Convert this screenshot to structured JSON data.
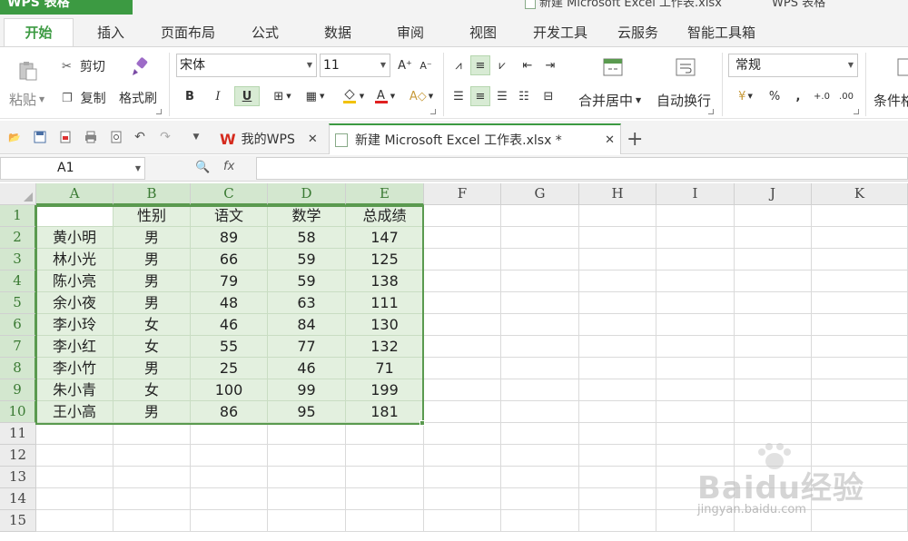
{
  "app": {
    "name": "WPS 表格",
    "document_title": "新建 Microsoft Excel 工作表.xlsx",
    "app_title": "WPS 表格"
  },
  "menu": {
    "tabs": [
      "开始",
      "插入",
      "页面布局",
      "公式",
      "数据",
      "审阅",
      "视图",
      "开发工具",
      "云服务",
      "智能工具箱"
    ],
    "active": "开始"
  },
  "ribbon": {
    "paste": "粘贴",
    "cut": "剪切",
    "copy": "复制",
    "format_painter": "格式刷",
    "font_name": "宋体",
    "font_size": "11",
    "grow_font": "A⁺",
    "shrink_font": "A⁻",
    "bold": "B",
    "italic": "I",
    "underline": "U",
    "merge_center": "合并居中",
    "wrap_text": "自动换行",
    "number_format": "常规",
    "percent": "%",
    "comma": ",",
    "conditional": "条件格"
  },
  "tabs_bar": {
    "tabs": [
      {
        "label": "我的WPS",
        "active": false
      },
      {
        "label": "新建 Microsoft Excel 工作表.xlsx *",
        "active": true
      }
    ],
    "new_tab": "+"
  },
  "formula_bar": {
    "cell_ref": "A1",
    "fx": "fx",
    "value": ""
  },
  "sheet": {
    "columns": [
      "A",
      "B",
      "C",
      "D",
      "E",
      "F",
      "G",
      "H",
      "I",
      "J",
      "K"
    ],
    "selected_columns": [
      "A",
      "B",
      "C",
      "D",
      "E"
    ],
    "rows": [
      "1",
      "2",
      "3",
      "4",
      "5",
      "6",
      "7",
      "8",
      "9",
      "10",
      "11",
      "12",
      "13",
      "14",
      "15"
    ],
    "selected_rows": [
      "1",
      "2",
      "3",
      "4",
      "5",
      "6",
      "7",
      "8",
      "9",
      "10"
    ],
    "data": [
      [
        "",
        "性别",
        "语文",
        "数学",
        "总成绩"
      ],
      [
        "黄小明",
        "男",
        "89",
        "58",
        "147"
      ],
      [
        "林小光",
        "男",
        "66",
        "59",
        "125"
      ],
      [
        "陈小亮",
        "男",
        "79",
        "59",
        "138"
      ],
      [
        "余小夜",
        "男",
        "48",
        "63",
        "111"
      ],
      [
        "李小玲",
        "女",
        "46",
        "84",
        "130"
      ],
      [
        "李小红",
        "女",
        "55",
        "77",
        "132"
      ],
      [
        "李小竹",
        "男",
        "25",
        "46",
        "71"
      ],
      [
        "朱小青",
        "女",
        "100",
        "99",
        "199"
      ],
      [
        "王小高",
        "男",
        "86",
        "95",
        "181"
      ]
    ]
  },
  "watermark": {
    "brand": "Baidu经验",
    "url": "jingyan.baidu.com"
  },
  "colors": {
    "accent": "#3c9a42",
    "selection_fill": "#e3f0df",
    "selection_border": "#5a9a4f"
  }
}
